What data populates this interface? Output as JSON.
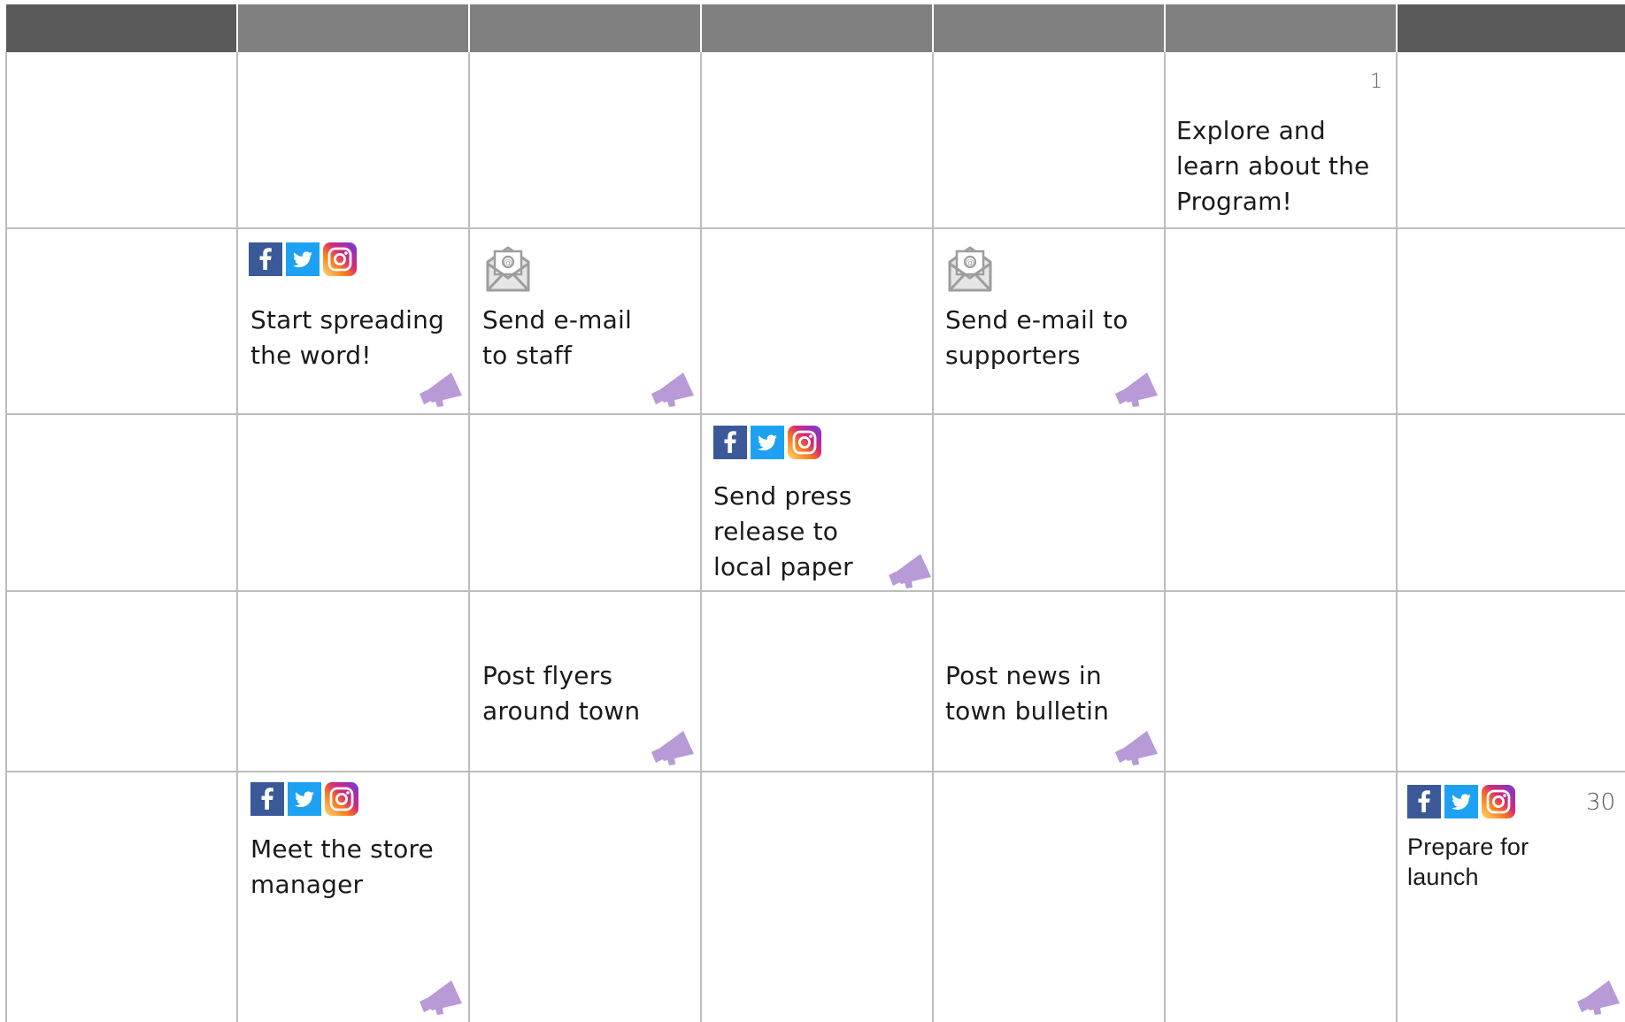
{
  "calendar": {
    "colors": {
      "header_dark": "#5a5a5a",
      "header_mid": "#808080",
      "grid": "#bdbdbd",
      "megaphone": "#b79ad6",
      "facebook": "#3b5998",
      "twitter": "#1da1f2",
      "mail_icon": "#9e9e9e"
    },
    "day_numbers": {
      "first": "1",
      "last": "30"
    },
    "events": {
      "explore": {
        "line1": "Explore and",
        "line2": "learn about the",
        "line3": "Program!"
      },
      "spread": {
        "line1": "Start spreading",
        "line2": "the word!",
        "icon": "social-media-icons"
      },
      "email_staff": {
        "line1": "Send e-mail",
        "line2": "to staff",
        "icon": "email-envelope-icon"
      },
      "email_supporters": {
        "line1": "Send e-mail to",
        "line2": "supporters",
        "icon": "email-envelope-icon"
      },
      "press": {
        "line1": "Send press",
        "line2": "release to",
        "line3": "local paper",
        "icon": "social-media-icons"
      },
      "flyers": {
        "line1": "Post flyers",
        "line2": "around town"
      },
      "bulletin": {
        "line1": "Post news in",
        "line2": "town bulletin"
      },
      "manager": {
        "line1": "Meet the store",
        "line2": "manager",
        "icon": "social-media-icons"
      },
      "launch": {
        "line1": "Prepare for",
        "line2": "launch",
        "icon": "social-media-icons"
      }
    },
    "badge_icon": "megaphone-icon"
  }
}
